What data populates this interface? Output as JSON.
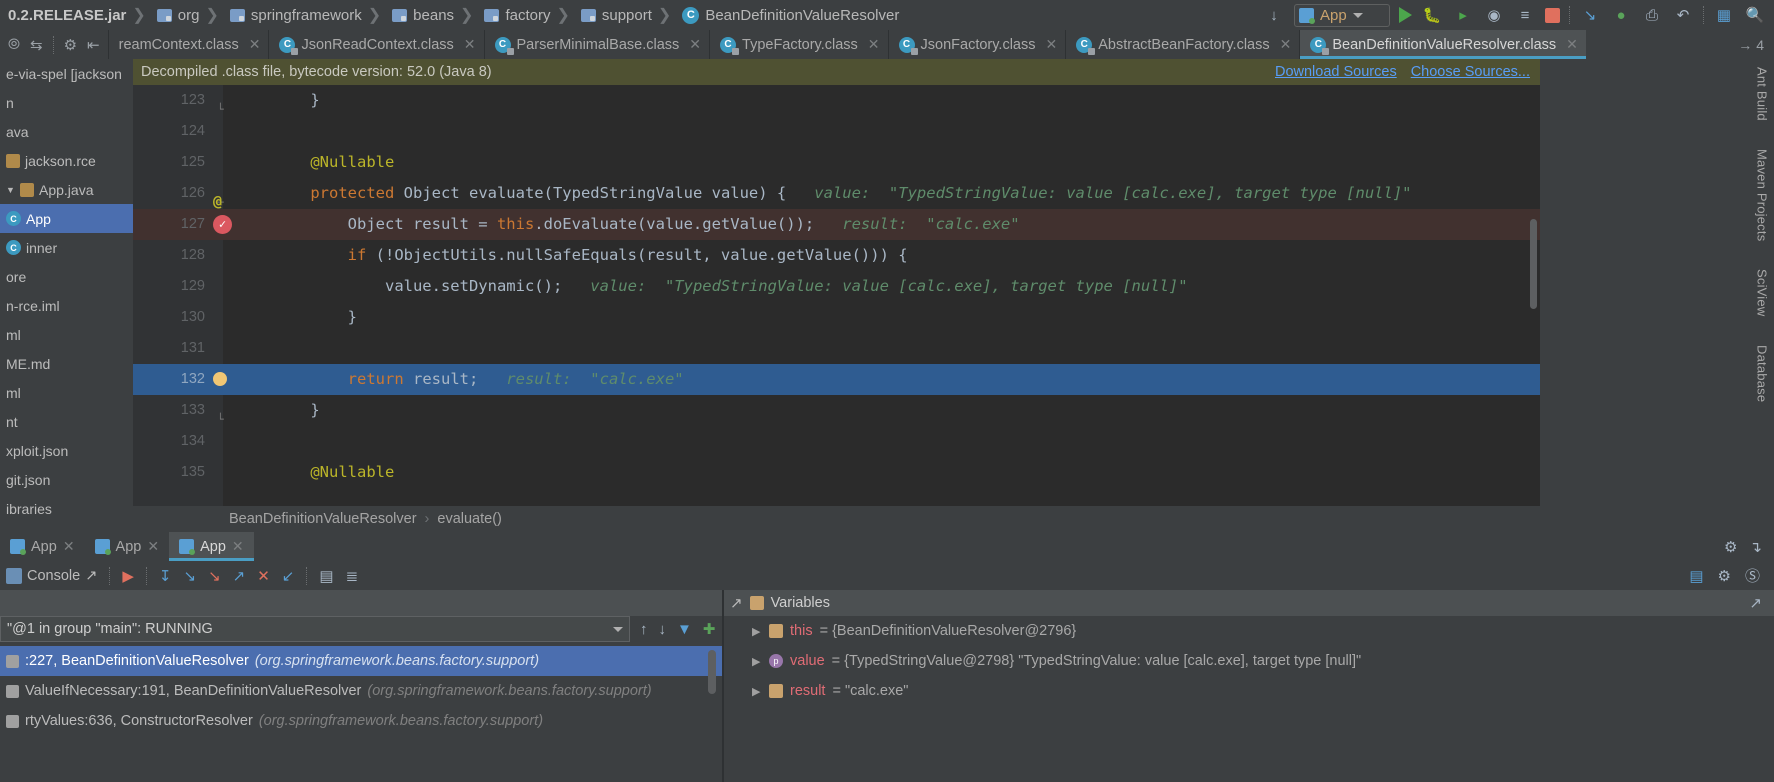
{
  "navbar": {
    "crumbs": [
      {
        "label": "0.2.RELEASE.jar",
        "icon": "",
        "bold": true
      },
      {
        "label": "org",
        "icon": "folder-icon"
      },
      {
        "label": "springframework",
        "icon": "folder-icon"
      },
      {
        "label": "beans",
        "icon": "folder-icon"
      },
      {
        "label": "factory",
        "icon": "folder-icon"
      },
      {
        "label": "support",
        "icon": "folder-icon"
      },
      {
        "label": "BeanDefinitionValueResolver",
        "icon": "class-icon"
      }
    ],
    "run_config": "App",
    "icons": [
      "compile-icon",
      "run-icon",
      "debug-icon",
      "run-coverage-icon",
      "profile-icon",
      "run-with-args-icon",
      "stop-icon",
      "attach-debugger-icon",
      "structure-icon",
      "update-app-icon",
      "revert-icon",
      "layout-icon",
      "search-icon"
    ]
  },
  "tabstrip": {
    "left_tools": [
      "collapse-all-icon",
      "expand-icon",
      "settings-icon",
      "hide-icon"
    ],
    "tabs": [
      {
        "label": "reamContext.class",
        "active": false,
        "icon": ""
      },
      {
        "label": "JsonReadContext.class",
        "active": false,
        "icon": "class-icon"
      },
      {
        "label": "ParserMinimalBase.class",
        "active": false,
        "icon": "class-icon"
      },
      {
        "label": "TypeFactory.class",
        "active": false,
        "icon": "class-icon"
      },
      {
        "label": "JsonFactory.class",
        "active": false,
        "icon": "class-icon"
      },
      {
        "label": "AbstractBeanFactory.class",
        "active": false,
        "icon": "class-icon"
      },
      {
        "label": "BeanDefinitionValueResolver.class",
        "active": true,
        "icon": "class-icon"
      }
    ],
    "count_label": "4"
  },
  "sidebar": {
    "items": [
      {
        "label": "e-via-spel [jackson",
        "kind": "module",
        "selected": false
      },
      {
        "label": "n",
        "kind": "folder",
        "selected": false
      },
      {
        "label": "ava",
        "kind": "folder",
        "selected": false
      },
      {
        "label": "jackson.rce",
        "kind": "package",
        "selected": false
      },
      {
        "label": "App.java",
        "kind": "java-file",
        "selected": false
      },
      {
        "label": "App",
        "kind": "class",
        "selected": true
      },
      {
        "label": "inner",
        "kind": "class",
        "selected": false
      },
      {
        "label": "ore",
        "kind": "folder",
        "selected": false
      },
      {
        "label": "n-rce.iml",
        "kind": "file",
        "selected": false
      },
      {
        "label": "ml",
        "kind": "file",
        "selected": false
      },
      {
        "label": "ME.md",
        "kind": "file",
        "selected": false
      },
      {
        "label": "ml",
        "kind": "file",
        "selected": false
      },
      {
        "label": "nt",
        "kind": "file",
        "selected": false
      },
      {
        "label": "xploit.json",
        "kind": "file",
        "selected": false
      },
      {
        "label": "git.json",
        "kind": "file",
        "selected": false
      },
      {
        "label": "ibraries",
        "kind": "folder",
        "selected": false
      }
    ]
  },
  "editor": {
    "banner": {
      "text": "Decompiled .class file, bytecode version: 52.0 (Java 8)",
      "download_sources": "Download Sources",
      "choose_sources": "Choose Sources..."
    },
    "lines": [
      {
        "num": "123",
        "marker": "",
        "fold": "end",
        "highlight": "",
        "tokens": [
          {
            "t": "    }",
            "c": ""
          }
        ]
      },
      {
        "num": "124",
        "marker": "",
        "fold": "",
        "highlight": "",
        "tokens": []
      },
      {
        "num": "125",
        "marker": "",
        "fold": "",
        "highlight": "",
        "tokens": [
          {
            "t": "    @Nullable",
            "c": "anno"
          }
        ]
      },
      {
        "num": "126",
        "marker": "at",
        "fold": "start",
        "highlight": "",
        "tokens": [
          {
            "t": "    ",
            "c": ""
          },
          {
            "t": "protected",
            "c": "kw"
          },
          {
            "t": " Object evaluate(TypedStringValue value) {",
            "c": ""
          },
          {
            "t": "   value:  \"TypedStringValue: value [calc.exe], target type [null]\"",
            "c": "hint"
          }
        ]
      },
      {
        "num": "127",
        "marker": "breakpoint",
        "fold": "",
        "highlight": "hl-red",
        "tokens": [
          {
            "t": "        Object result = ",
            "c": ""
          },
          {
            "t": "this",
            "c": "kw"
          },
          {
            "t": ".doEvaluate(value.getValue());",
            "c": ""
          },
          {
            "t": "   result:  \"calc.exe\"",
            "c": "hint"
          }
        ]
      },
      {
        "num": "128",
        "marker": "",
        "fold": "",
        "highlight": "",
        "tokens": [
          {
            "t": "        ",
            "c": ""
          },
          {
            "t": "if",
            "c": "kw"
          },
          {
            "t": " (!ObjectUtils.nullSafeEquals(result, value.getValue())) {",
            "c": ""
          }
        ]
      },
      {
        "num": "129",
        "marker": "",
        "fold": "",
        "highlight": "",
        "tokens": [
          {
            "t": "            value.setDynamic();",
            "c": ""
          },
          {
            "t": "   value:  \"TypedStringValue: value [calc.exe], target type [null]\"",
            "c": "hint"
          }
        ]
      },
      {
        "num": "130",
        "marker": "",
        "fold": "",
        "highlight": "",
        "tokens": [
          {
            "t": "        }",
            "c": ""
          }
        ]
      },
      {
        "num": "131",
        "marker": "",
        "fold": "",
        "highlight": "",
        "tokens": []
      },
      {
        "num": "132",
        "marker": "bulb",
        "fold": "",
        "highlight": "hl-blue",
        "tokens": [
          {
            "t": "        ",
            "c": ""
          },
          {
            "t": "return",
            "c": "kw"
          },
          {
            "t": " result;",
            "c": ""
          },
          {
            "t": "   result:  \"calc.exe\"",
            "c": "hint"
          }
        ]
      },
      {
        "num": "133",
        "marker": "",
        "fold": "end",
        "highlight": "",
        "tokens": [
          {
            "t": "    }",
            "c": ""
          }
        ]
      },
      {
        "num": "134",
        "marker": "",
        "fold": "",
        "highlight": "",
        "tokens": []
      },
      {
        "num": "135",
        "marker": "",
        "fold": "",
        "highlight": "",
        "tokens": [
          {
            "t": "    @Nullable",
            "c": "anno"
          }
        ]
      }
    ],
    "breadcrumb": {
      "class": "BeanDefinitionValueResolver",
      "sep": "›",
      "method": "evaluate()"
    }
  },
  "rightbar": {
    "labels": [
      "Ant Build",
      "Maven Projects",
      "SciView",
      "Database"
    ]
  },
  "debug": {
    "tabs": [
      {
        "label": "App",
        "active": false
      },
      {
        "label": "App",
        "active": false
      },
      {
        "label": "App",
        "active": true
      }
    ],
    "toolbar": {
      "console_label": "Console",
      "buttons": [
        "show-execution-point-icon",
        "step-over-icon",
        "step-into-icon",
        "force-step-into-icon",
        "step-out-icon",
        "drop-frame-icon",
        "run-to-cursor-icon",
        "evaluate-expression-icon",
        "sort-icon"
      ],
      "right_buttons": [
        "layout-settings-icon",
        "settings-icon",
        "mute-breakpoints-icon"
      ]
    },
    "variables_title": "Variables",
    "frames": {
      "thread_label": "\"@1 in group \"main\": RUNNING",
      "rows": [
        {
          "method": ":227, BeanDefinitionValueResolver",
          "pkg": "(org.springframework.beans.factory.support)",
          "selected": true
        },
        {
          "method": "ValueIfNecessary:191, BeanDefinitionValueResolver",
          "pkg": "(org.springframework.beans.factory.support)",
          "selected": false
        },
        {
          "method": "rtyValues:636, ConstructorResolver",
          "pkg": "(org.springframework.beans.factory.support)",
          "selected": false
        }
      ]
    },
    "variables": [
      {
        "name": "this",
        "value": "= {BeanDefinitionValueResolver@2796}",
        "kind": "object",
        "expandable": true
      },
      {
        "name": "value",
        "value": "= {TypedStringValue@2798} \"TypedStringValue: value [calc.exe], target type [null]\"",
        "kind": "param",
        "expandable": true
      },
      {
        "name": "result",
        "value": "= \"calc.exe\"",
        "kind": "object",
        "expandable": true
      }
    ]
  },
  "colors": {
    "accent": "#4a9ec4",
    "selection": "#4b6eaf",
    "editor_bg": "#2b2b2b",
    "breakpoint_red": "#db5860",
    "keyword_orange": "#cc7832",
    "hint_green": "#5f8c6b"
  }
}
